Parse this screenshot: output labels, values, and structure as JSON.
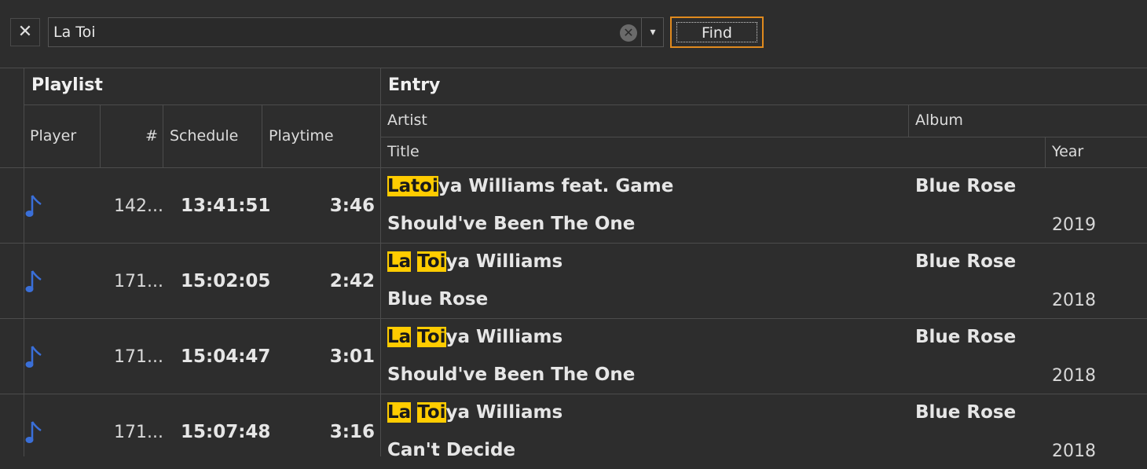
{
  "toolbar": {
    "close_glyph": "✕",
    "search_value": "La Toi",
    "clear_glyph": "✕",
    "dropdown_glyph": "▾",
    "find_label": "Find"
  },
  "headers": {
    "playlist_group": "Playlist",
    "entry_group": "Entry",
    "player": "Player",
    "number": "#",
    "schedule": "Schedule",
    "playtime": "Playtime",
    "artist": "Artist",
    "album": "Album",
    "title": "Title",
    "year": "Year"
  },
  "rows": [
    {
      "player_icon": "music-note-icon",
      "number": "142...",
      "schedule": "13:41:51",
      "playtime": "3:46",
      "artist_parts": [
        {
          "text": "Latoi",
          "highlight": true
        },
        {
          "text": "ya Williams feat. Game",
          "highlight": false
        }
      ],
      "album": "Blue Rose",
      "title": "Should've Been The One",
      "year": "2019"
    },
    {
      "player_icon": "music-note-icon",
      "number": "171...",
      "schedule": "15:02:05",
      "playtime": "2:42",
      "artist_parts": [
        {
          "text": "La",
          "highlight": true
        },
        {
          "text": " ",
          "highlight": false
        },
        {
          "text": "Toi",
          "highlight": true
        },
        {
          "text": "ya Williams",
          "highlight": false
        }
      ],
      "album": "Blue Rose",
      "title": "Blue Rose",
      "year": "2018"
    },
    {
      "player_icon": "music-note-icon",
      "number": "171...",
      "schedule": "15:04:47",
      "playtime": "3:01",
      "artist_parts": [
        {
          "text": "La",
          "highlight": true
        },
        {
          "text": " ",
          "highlight": false
        },
        {
          "text": "Toi",
          "highlight": true
        },
        {
          "text": "ya Williams",
          "highlight": false
        }
      ],
      "album": "Blue Rose",
      "title": "Should've Been The One",
      "year": "2018"
    },
    {
      "player_icon": "music-note-icon",
      "number": "171...",
      "schedule": "15:07:48",
      "playtime": "3:16",
      "artist_parts": [
        {
          "text": "La",
          "highlight": true
        },
        {
          "text": " ",
          "highlight": false
        },
        {
          "text": "Toi",
          "highlight": true
        },
        {
          "text": "ya Williams",
          "highlight": false
        }
      ],
      "album": "Blue Rose",
      "title": "Can't Decide",
      "year": "2018"
    }
  ],
  "colors": {
    "background": "#2d2d2d",
    "highlight": "#ffcc00",
    "find_border": "#e08a1e",
    "note_icon": "#3a6fd8"
  }
}
